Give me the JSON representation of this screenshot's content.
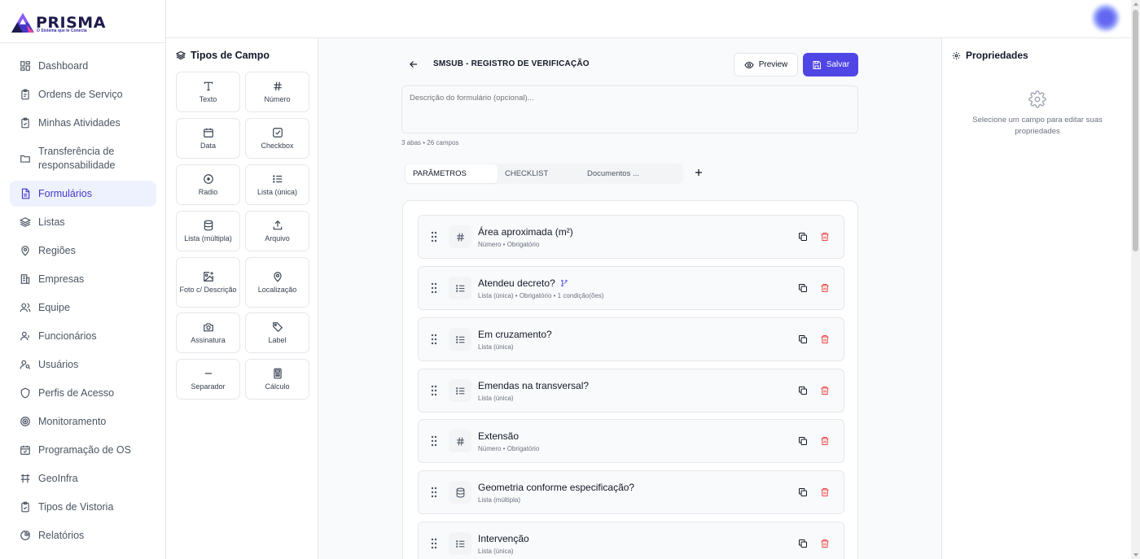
{
  "brand": {
    "name": "PRISMA",
    "tagline": "O Sistema que te Conecta"
  },
  "sidebar": {
    "items": [
      {
        "label": "Dashboard",
        "icon": "dashboard-icon"
      },
      {
        "label": "Ordens de Serviço",
        "icon": "clipboard-icon"
      },
      {
        "label": "Minhas Atividades",
        "icon": "clipboard-check-icon"
      },
      {
        "label": "Transferência de responsabilidade",
        "icon": "folder-icon"
      },
      {
        "label": "Formulários",
        "icon": "file-text-icon",
        "active": true
      },
      {
        "label": "Listas",
        "icon": "layers-icon"
      },
      {
        "label": "Regiões",
        "icon": "map-pin-icon"
      },
      {
        "label": "Empresas",
        "icon": "building-icon"
      },
      {
        "label": "Equipe",
        "icon": "users-icon"
      },
      {
        "label": "Funcionários",
        "icon": "user-icon"
      },
      {
        "label": "Usuários",
        "icon": "user-key-icon"
      },
      {
        "label": "Perfis de Acesso",
        "icon": "shield-icon"
      },
      {
        "label": "Monitoramento",
        "icon": "target-icon"
      },
      {
        "label": "Programação de OS",
        "icon": "calendar-check-icon"
      },
      {
        "label": "GeoInfra",
        "icon": "network-icon"
      },
      {
        "label": "Tipos de Vistoria",
        "icon": "clipboard-check-icon"
      },
      {
        "label": "Relatórios",
        "icon": "pie-chart-icon"
      }
    ]
  },
  "field_types": {
    "title": "Tipos de Campo",
    "items": [
      {
        "label": "Texto",
        "icon": "type-icon"
      },
      {
        "label": "Número",
        "icon": "hash-icon"
      },
      {
        "label": "Data",
        "icon": "calendar-icon"
      },
      {
        "label": "Checkbox",
        "icon": "checkbox-icon"
      },
      {
        "label": "Radio",
        "icon": "radio-icon"
      },
      {
        "label": "Lista (única)",
        "icon": "list-icon"
      },
      {
        "label": "Lista (múltipla)",
        "icon": "database-icon"
      },
      {
        "label": "Arquivo",
        "icon": "upload-icon"
      },
      {
        "label": "Foto c/ Descrição",
        "icon": "image-plus-icon"
      },
      {
        "label": "Localização",
        "icon": "map-pin-icon"
      },
      {
        "label": "Assinatura",
        "icon": "camera-icon"
      },
      {
        "label": "Label",
        "icon": "tag-icon"
      },
      {
        "label": "Separador",
        "icon": "minus-icon"
      },
      {
        "label": "Cálculo",
        "icon": "calculator-icon"
      }
    ]
  },
  "form": {
    "title": "SMSUB - REGISTRO DE VERIFICAÇÃO",
    "preview_label": "Preview",
    "save_label": "Salvar",
    "description_placeholder": "Descrição do formulário (opcional)...",
    "meta": "3 abas • 26 campos",
    "tabs": [
      {
        "label": "PARÂMETROS",
        "active": true
      },
      {
        "label": "CHECKLIST"
      },
      {
        "label": "Documentos ..."
      }
    ],
    "fields": [
      {
        "name": "Área aproximada (m²)",
        "sub": "Número • Obrigatório",
        "icon": "hash-icon"
      },
      {
        "name": "Atendeu decreto?",
        "sub": "Lista (única) • Obrigatório • 1 condição(ões)",
        "icon": "list-icon",
        "branch": true
      },
      {
        "name": "Em cruzamento?",
        "sub": "Lista (única)",
        "icon": "list-icon"
      },
      {
        "name": "Emendas na transversal?",
        "sub": "Lista (única)",
        "icon": "list-icon"
      },
      {
        "name": "Extensão",
        "sub": "Número • Obrigatório",
        "icon": "hash-icon"
      },
      {
        "name": "Geometria conforme especificação?",
        "sub": "Lista (múltipla)",
        "icon": "database-icon"
      },
      {
        "name": "Intervenção",
        "sub": "Lista (única)",
        "icon": "list-icon"
      }
    ]
  },
  "properties": {
    "title": "Propriedades",
    "hint": "Selecione um campo para editar suas propriedades"
  },
  "colors": {
    "accent": "#4f46e5",
    "active_bg": "#eef2ff",
    "delete": "#ef4444"
  }
}
